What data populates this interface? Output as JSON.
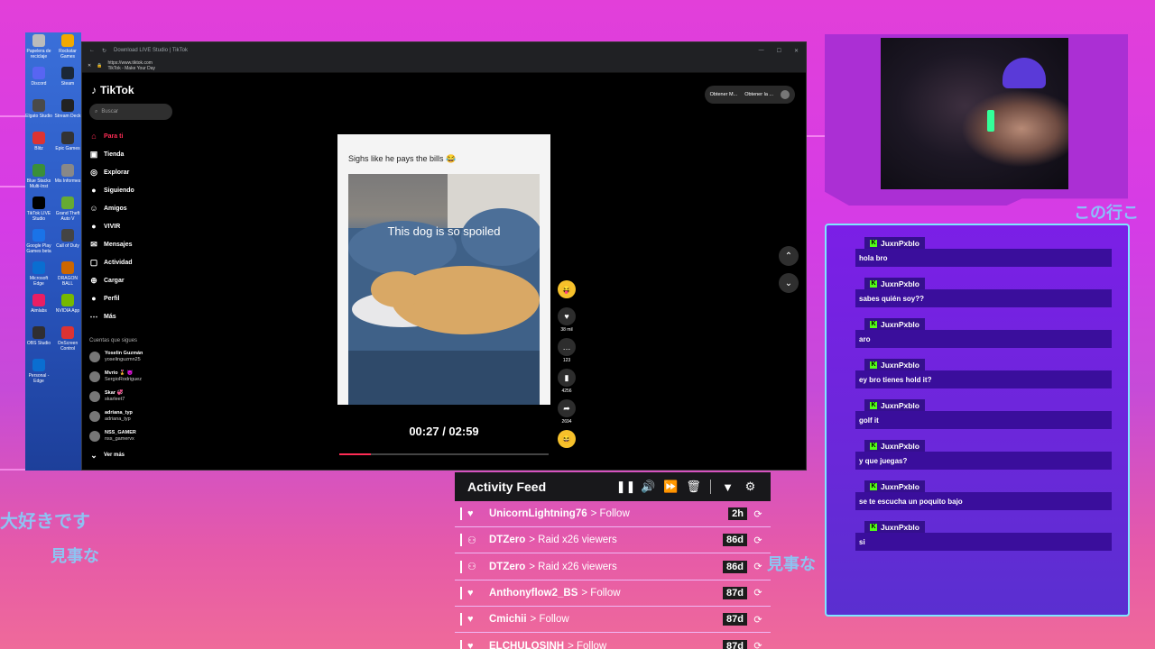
{
  "background": {
    "japanese_text": [
      "大好きです",
      "見事な",
      "見事な",
      "この行こ"
    ]
  },
  "desktop": {
    "icons": [
      "Papelera de reciclaje",
      "Rockstar Games",
      "Discord",
      "Steam",
      "Elgato Studio",
      "Stream Deck",
      "Blitz",
      "Epic Games",
      "Blue Stacks Multi-Inst",
      "Mis Informes",
      "TikTok LIVE Studio",
      "Grand Theft Auto V",
      "Google Play Games beta",
      "Call of Duty",
      "Microsoft Edge",
      "DRAGON BALL",
      "Aimlabs",
      "NVIDIA App",
      "OBS Studio",
      "OnScreen Control",
      "Personal - Edge"
    ]
  },
  "browser": {
    "window_title": "Download LIVE Studio | TikTok",
    "url": "https://www.tiktok.com",
    "page_title": "TikTok - Make Your Day"
  },
  "tiktok": {
    "logo": "TikTok",
    "search_placeholder": "Buscar",
    "nav": [
      {
        "label": "Para ti",
        "icon": "home-icon",
        "glyph": "⌂"
      },
      {
        "label": "Tienda",
        "icon": "shop-icon",
        "glyph": "▣"
      },
      {
        "label": "Explorar",
        "icon": "compass-icon",
        "glyph": "◎"
      },
      {
        "label": "Siguiendo",
        "icon": "following-icon",
        "glyph": "●"
      },
      {
        "label": "Amigos",
        "icon": "friends-icon",
        "glyph": "☺"
      },
      {
        "label": "VIVIR",
        "icon": "live-icon",
        "glyph": "●"
      },
      {
        "label": "Mensajes",
        "icon": "messages-icon",
        "glyph": "✉"
      },
      {
        "label": "Actividad",
        "icon": "activity-icon",
        "glyph": "▢"
      },
      {
        "label": "Cargar",
        "icon": "upload-icon",
        "glyph": "⊕"
      },
      {
        "label": "Perfil",
        "icon": "profile-icon",
        "glyph": "●"
      },
      {
        "label": "Más",
        "icon": "more-icon",
        "glyph": "⋯"
      }
    ],
    "following_header": "Cuentas que sigues",
    "following": [
      {
        "name": "Yoselin Guzmán",
        "handle": "yoselinguzmn25"
      },
      {
        "name": "Mvrio 🎖️ 😈",
        "handle": "SergioRodriguez"
      },
      {
        "name": "Skar 💞",
        "handle": "skarleet7"
      },
      {
        "name": "adriana_typ",
        "handle": "adriana_typ"
      },
      {
        "name": "NSS_GAMER",
        "handle": "nss_gamervx"
      }
    ],
    "see_more": "Ver más",
    "top_buttons": [
      "Obtener M...",
      "Obtener la ..."
    ],
    "video": {
      "caption": "Sighs like he pays the bills 😂",
      "overlay": "This dog is so spoiled",
      "timestamp": "00:27 / 02:59",
      "progress": 0.15
    },
    "actions": [
      {
        "icon": "heart-icon",
        "glyph": "♥",
        "count": "38 mil"
      },
      {
        "icon": "comment-icon",
        "glyph": "…",
        "count": "123"
      },
      {
        "icon": "bookmark-icon",
        "glyph": "▮",
        "count": "4256"
      },
      {
        "icon": "share-icon",
        "glyph": "➦",
        "count": "2694"
      }
    ]
  },
  "chat": {
    "messages": [
      {
        "user": "JuxnPxblo",
        "text": "hola bro"
      },
      {
        "user": "JuxnPxblo",
        "text": "sabes quién soy??"
      },
      {
        "user": "JuxnPxblo",
        "text": "aro"
      },
      {
        "user": "JuxnPxblo",
        "text": "ey bro tienes hold it?"
      },
      {
        "user": "JuxnPxblo",
        "text": "golf it"
      },
      {
        "user": "JuxnPxblo",
        "text": "y que juegas?"
      },
      {
        "user": "JuxnPxblo",
        "text": "se te escucha un poquito bajo"
      },
      {
        "user": "JuxnPxblo",
        "text": "si"
      }
    ],
    "badge_letter": "K"
  },
  "activity_feed": {
    "title": "Activity Feed",
    "events": [
      {
        "icon": "heart-icon",
        "glyph": "♥",
        "user": "UnicornLightning76",
        "action": "> Follow",
        "age": "2h"
      },
      {
        "icon": "raid-icon",
        "glyph": "⚇",
        "user": "DTZero",
        "action": "> Raid x26 viewers",
        "age": "86d"
      },
      {
        "icon": "raid-icon",
        "glyph": "⚇",
        "user": "DTZero",
        "action": "> Raid x26 viewers",
        "age": "86d"
      },
      {
        "icon": "heart-icon",
        "glyph": "♥",
        "user": "Anthonyflow2_BS",
        "action": "> Follow",
        "age": "87d"
      },
      {
        "icon": "heart-icon",
        "glyph": "♥",
        "user": "Cmichii",
        "action": "> Follow",
        "age": "87d"
      },
      {
        "icon": "heart-icon",
        "glyph": "♥",
        "user": "ELCHULOSINH",
        "action": "> Follow",
        "age": "87d"
      }
    ]
  },
  "colors": {
    "tiktok_red": "#fe2c55",
    "kick_green": "#53fc18",
    "chat_border": "#7ee7ff"
  }
}
